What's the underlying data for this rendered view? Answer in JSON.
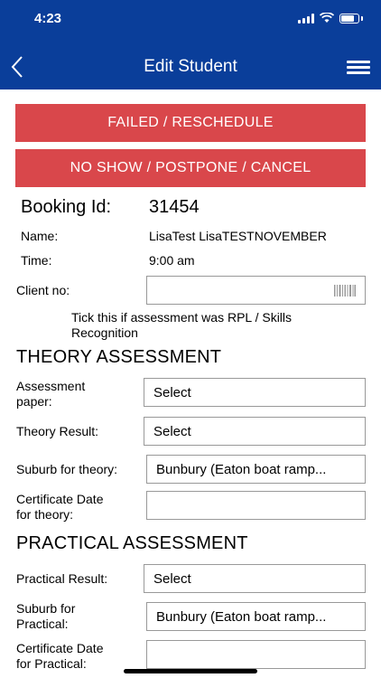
{
  "status_bar": {
    "time": "4:23"
  },
  "nav": {
    "title": "Edit Student"
  },
  "actions": {
    "failed_label": "FAILED / RESCHEDULE",
    "noshow_label": "NO SHOW / POSTPONE / CANCEL"
  },
  "booking": {
    "id_label": "Booking Id:",
    "id_value": "31454",
    "name_label": "Name:",
    "name_value": "LisaTest LisaTESTNOVEMBER",
    "time_label": "Time:",
    "time_value": "9:00 am",
    "client_label": "Client no:",
    "client_value": ""
  },
  "rpl": {
    "text_line1": "Tick this if assessment was RPL / Skills",
    "text_line2": "Recognition"
  },
  "theory": {
    "heading": "THEORY ASSESSMENT",
    "paper_label_1": "Assessment",
    "paper_label_2": "paper:",
    "paper_value": "Select",
    "result_label": "Theory Result:",
    "result_value": "Select",
    "suburb_label": "Suburb for theory:",
    "suburb_value": "Bunbury (Eaton boat ramp...",
    "cert_label_1": "Certificate Date",
    "cert_label_2": "for theory:",
    "cert_value": ""
  },
  "practical": {
    "heading": "PRACTICAL ASSESSMENT",
    "result_label": "Practical Result:",
    "result_value": "Select",
    "suburb_label_1": "Suburb for",
    "suburb_label_2": "Practical:",
    "suburb_value": "Bunbury (Eaton boat ramp...",
    "cert_label_1": "Certificate Date",
    "cert_label_2": "for Practical:",
    "cert_value": ""
  },
  "colors": {
    "header": "#0a3e9a",
    "danger": "#d9474b"
  },
  "icons": [
    "chevron-left-icon",
    "hamburger-menu-icon",
    "barcode-icon",
    "wifi-icon",
    "battery-icon",
    "signal-icon"
  ]
}
